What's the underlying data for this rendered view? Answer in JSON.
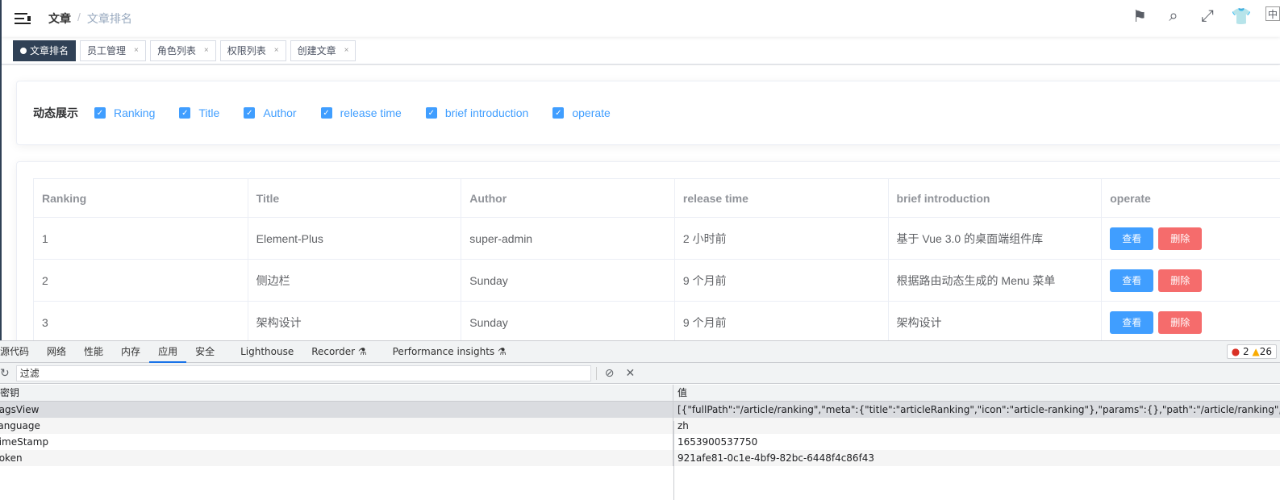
{
  "header": {
    "breadcrumb": [
      "文章",
      "/",
      "文章排名"
    ],
    "icons": [
      "guide-icon",
      "search-icon",
      "fullscreen-icon",
      "theme-icon",
      "language-icon"
    ]
  },
  "tags": [
    {
      "label": "文章排名",
      "active": true
    },
    {
      "label": "员工管理"
    },
    {
      "label": "角色列表"
    },
    {
      "label": "权限列表"
    },
    {
      "label": "创建文章"
    }
  ],
  "close_glyph": "×",
  "dynamic": {
    "label": "动态展示",
    "options": [
      "Ranking",
      "Title",
      "Author",
      "release time",
      "brief introduction",
      "operate"
    ]
  },
  "table": {
    "columns": [
      "Ranking",
      "Title",
      "Author",
      "release time",
      "brief introduction",
      "operate"
    ],
    "rows": [
      [
        "1",
        "Element-Plus",
        "super-admin",
        "2 小时前",
        "基于 Vue 3.0 的桌面端组件库"
      ],
      [
        "2",
        "侧边栏",
        "Sunday",
        "9 个月前",
        "根据路由动态生成的 Menu 菜单"
      ],
      [
        "3",
        "架构设计",
        "Sunday",
        "9 个月前",
        "架构设计"
      ]
    ],
    "view_label": "查看",
    "delete_label": "删除"
  },
  "devtools": {
    "tabs": [
      "源代码",
      "网络",
      "性能",
      "内存",
      "应用",
      "安全",
      "Lighthouse",
      "Recorder ⚗",
      "Performance insights ⚗"
    ],
    "active_tab": "应用",
    "issues": {
      "errors": "2",
      "warnings": "26"
    },
    "filter_placeholder": "过滤",
    "key_header": "密钥",
    "value_header": "值",
    "rows": [
      [
        "tagsView",
        "[{\"fullPath\":\"/article/ranking\",\"meta\":{\"title\":\"articleRanking\",\"icon\":\"article-ranking\"},\"params\":{},\"path\":\"/article/ranking\",\"query\":{},\"title\":\"文章"
      ],
      [
        "language",
        "zh"
      ],
      [
        "timeStamp",
        "1653900537750"
      ],
      [
        "token",
        "921afe81-0c1e-4bf9-82bc-6448f4c86f43"
      ]
    ]
  }
}
